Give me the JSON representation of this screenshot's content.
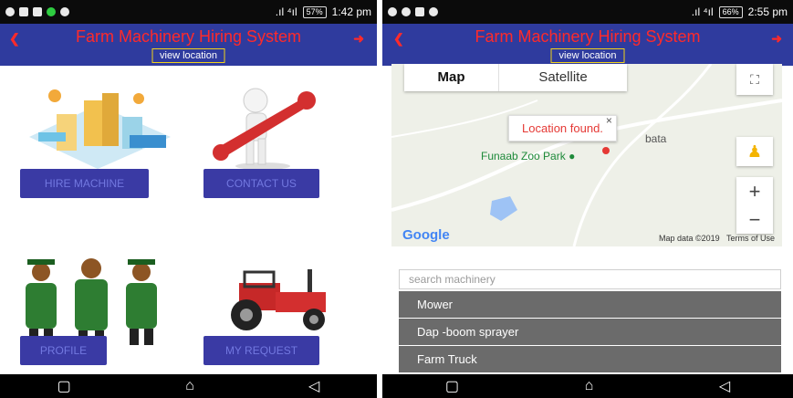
{
  "left_screen": {
    "status": {
      "time": "1:42 pm",
      "battery": "57%"
    },
    "app_title": "Farm Machinery Hiring System",
    "view_location_label": "view location",
    "buttons": {
      "hire": "HIRE MACHINE",
      "contact": "CONTACT US",
      "profile": "PROFILE",
      "request": "MY REQUEST"
    }
  },
  "right_screen": {
    "status": {
      "time": "2:55 pm",
      "battery": "66%"
    },
    "app_title": "Farm Machinery Hiring System",
    "view_location_label": "view location",
    "map": {
      "tab_map": "Map",
      "tab_satellite": "Satellite",
      "popup_text": "Location found.",
      "place_label": "Funaab Zoo Park",
      "road_label": "bata",
      "google_label": "Google",
      "map_data": "Map data ©2019",
      "terms": "Terms of Use"
    },
    "search_placeholder": "search machinery",
    "machinery_items": [
      "Mower",
      "Dap -boom sprayer",
      "Farm Truck"
    ]
  }
}
